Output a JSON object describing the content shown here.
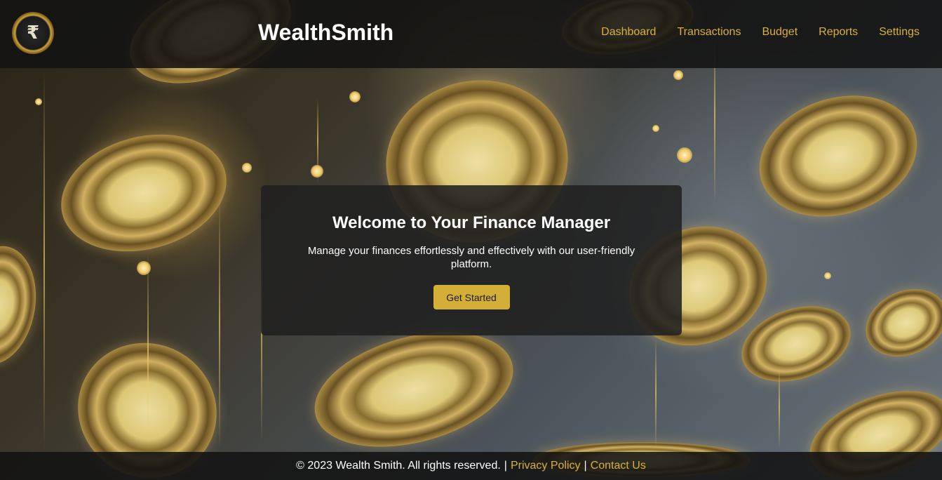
{
  "header": {
    "logo_symbol": "₹",
    "brand": "WealthSmith",
    "nav": [
      "Dashboard",
      "Transactions",
      "Budget",
      "Reports",
      "Settings"
    ]
  },
  "hero": {
    "title": "Welcome to Your Finance Manager",
    "description": "Manage your finances effortlessly and effectively with our user-friendly platform.",
    "cta_label": "Get Started"
  },
  "footer": {
    "copyright": "© 2023 Wealth Smith. All rights reserved.",
    "separator": "|",
    "links": [
      "Privacy Policy",
      "Contact Us"
    ]
  },
  "colors": {
    "accent": "#d4af37",
    "nav_link": "#d8b13c",
    "header_bg": "#121212",
    "card_bg": "#202020"
  },
  "background": "gold coins falling on dark gradient"
}
